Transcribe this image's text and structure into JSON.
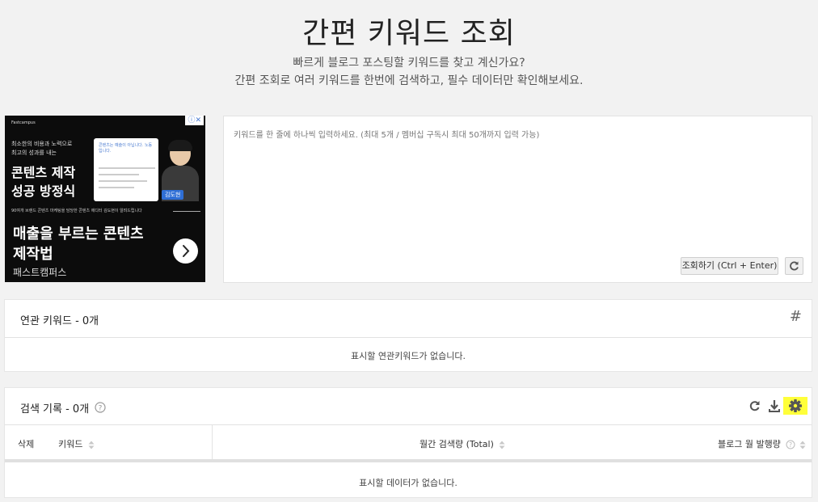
{
  "header": {
    "title": "간편 키워드 조회",
    "subtitle_line1": "빠르게 블로그 포스팅할 키워드를 찾고 계신가요?",
    "subtitle_line2": "간편 조회로 여러 키워드를 한번에 검색하고, 필수 데이터만 확인해보세요."
  },
  "ad": {
    "brand": "Fastcampus",
    "intro_line1": "최소한의 비용과 노력으로",
    "intro_line2": "최고의 성과를 내는",
    "headline_line1": "콘텐츠 제작",
    "headline_line2": "성공 방정식",
    "card_note": "콘텐츠는 예술이 아닙니다. 노동입니다.",
    "name_tag": "김도현",
    "mid_text": "90여개 브랜드 콘텐츠 마케팅을 담당한 콘텐츠 에디터 김도현이 알려드립니다",
    "big_line1": "매출을 부르는 콘텐츠",
    "big_line2": "제작법",
    "brand_name": "패스트캠퍼스",
    "adchoice": "ⓘ✕"
  },
  "input": {
    "placeholder": "키워드를 한 줄에 하나씩 입력하세요. (최대 5개 / 멤버십 구독시 최대 50개까지 입력 가능)",
    "value": "",
    "search_button": "조회하기 (Ctrl + Enter)"
  },
  "related": {
    "title": "연관 키워드 - 0개",
    "empty_message": "표시할 연관키워드가 없습니다."
  },
  "history": {
    "title": "검색 기록 - 0개",
    "columns": {
      "delete": "삭제",
      "keyword": "키워드",
      "monthly": "월간 검색량 (Total)",
      "blog": "블로그 월 발행량"
    },
    "empty_message": "표시할 데이터가 없습니다."
  },
  "colors": {
    "background": "#f2f2f2",
    "panel": "#ffffff",
    "highlight": "#ffff3a"
  }
}
